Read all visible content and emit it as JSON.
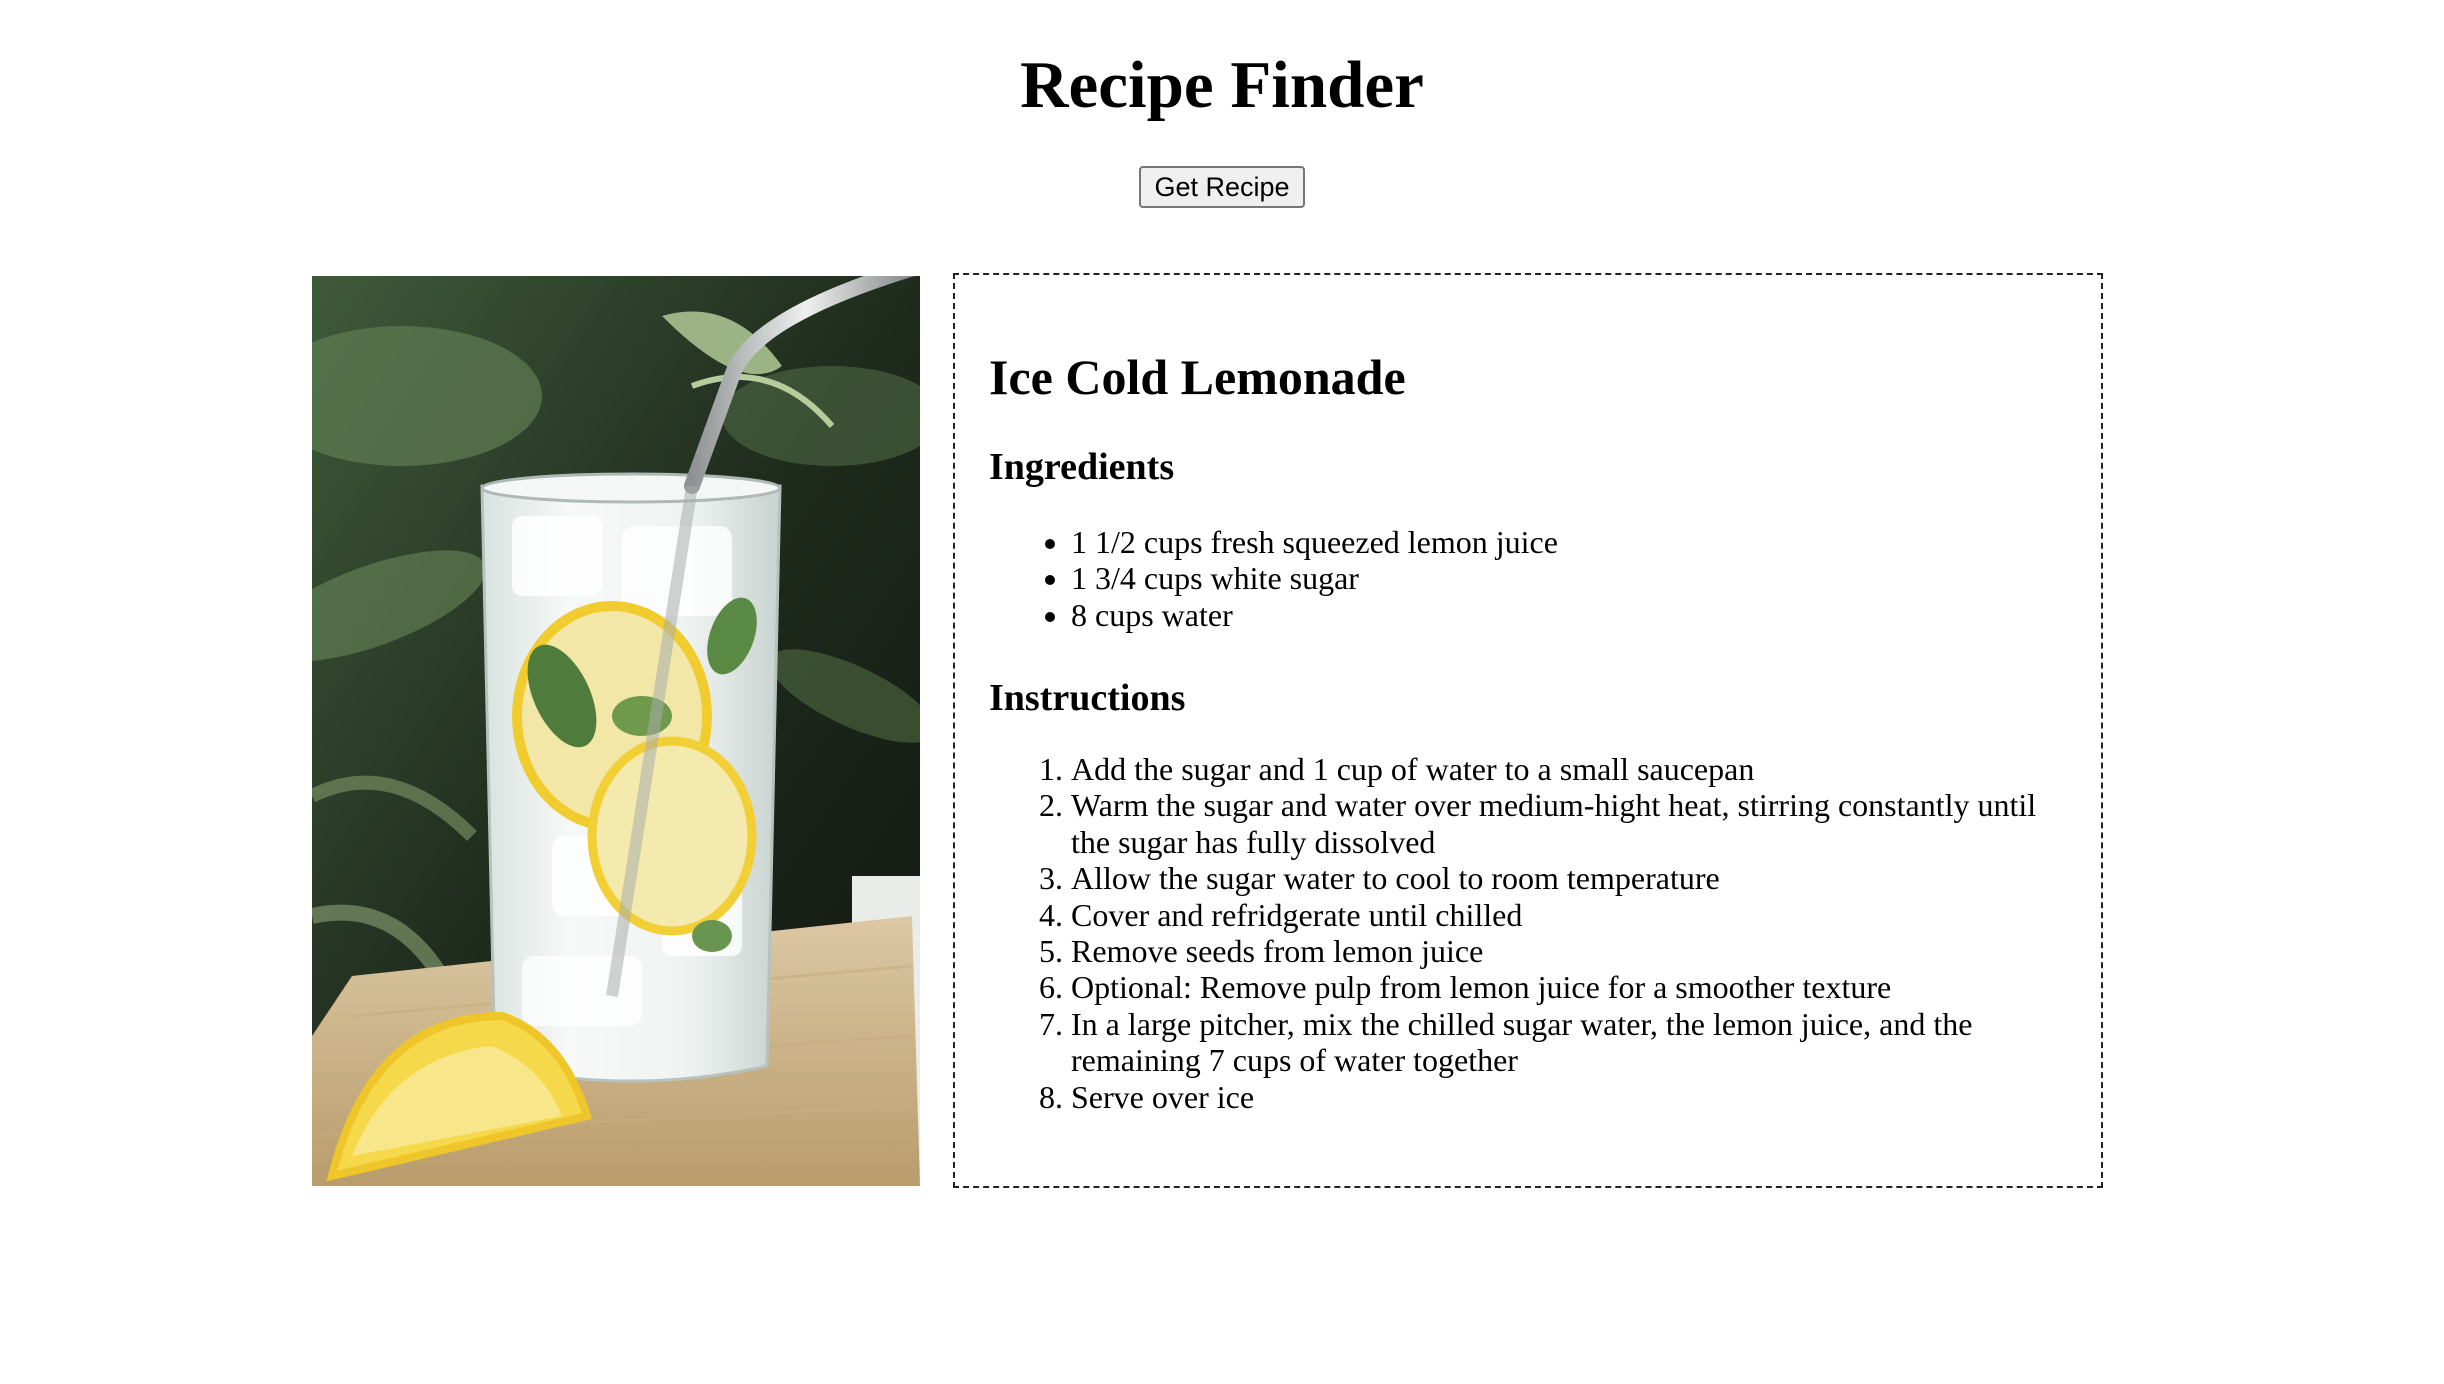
{
  "header": {
    "title": "Recipe Finder",
    "get_recipe_label": "Get Recipe"
  },
  "recipe": {
    "image_alt": "Glass of ice lemonade with a metal straw, lemon slices and mint on a wooden board",
    "name": "Ice Cold Lemonade",
    "ingredients_heading": "Ingredients",
    "ingredients": [
      "1 1/2 cups fresh squeezed lemon juice",
      "1 3/4 cups white sugar",
      "8 cups water"
    ],
    "instructions_heading": "Instructions",
    "instructions": [
      "Add the sugar and 1 cup of water to a small saucepan",
      "Warm the sugar and water over medium-hight heat, stirring constantly until the sugar has fully dissolved",
      "Allow the sugar water to cool to room temperature",
      "Cover and refridgerate until chilled",
      "Remove seeds from lemon juice",
      "Optional: Remove pulp from lemon juice for a smoother texture",
      "In a large pitcher, mix the chilled sugar water, the lemon juice, and the remaining 7 cups of water together",
      "Serve over ice"
    ]
  },
  "colors": {
    "background": "#ffffff",
    "text": "#000000",
    "card_border": "#222222",
    "button_bg": "#efefef",
    "button_border": "#767676"
  }
}
